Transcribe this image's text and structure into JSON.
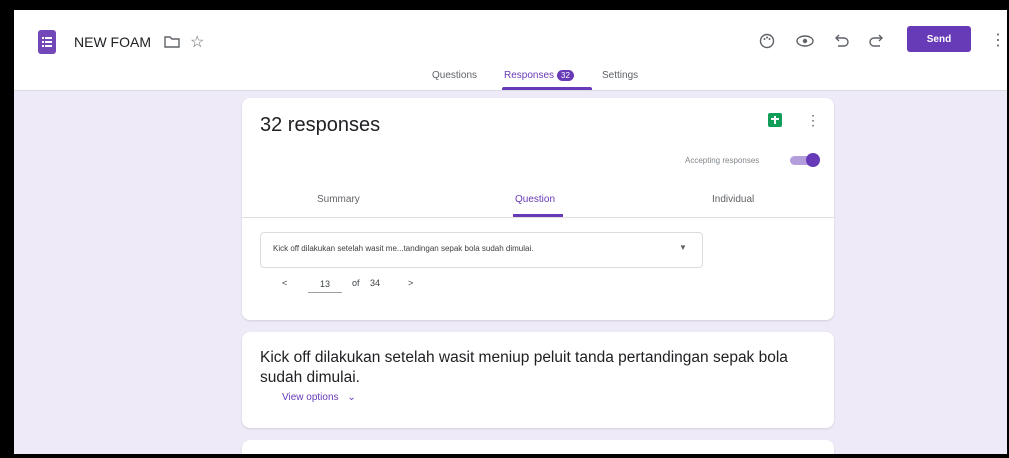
{
  "header": {
    "doc_title": "NEW FOAM",
    "send_label": "Send",
    "icons": [
      "forms-icon",
      "folder-icon",
      "star-icon",
      "palette-icon",
      "preview-icon",
      "undo-icon",
      "redo-icon",
      "more-vert-icon"
    ]
  },
  "main_tabs": {
    "questions": "Questions",
    "responses": "Responses",
    "responses_count": "32",
    "settings": "Settings"
  },
  "responses_card": {
    "title": "32 responses",
    "accepting_label": "Accepting responses",
    "accepting": true,
    "subtabs": {
      "summary": "Summary",
      "question": "Question",
      "individual": "Individual"
    },
    "selected_question": "Kick off dilakukan setelah wasit me...tandingan sepak bola sudah dimulai.",
    "pager": {
      "current": "13",
      "of_label": "of",
      "total": "34",
      "prev": "<",
      "next": ">"
    }
  },
  "question_card": {
    "text": "Kick off dilakukan setelah wasit meniup peluit tanda pertandingan sepak bola sudah dimulai.",
    "view_options": "View options"
  },
  "colors": {
    "accent": "#673ab7",
    "page_bg": "#efeaf7",
    "sheets_green": "#0f9d58"
  }
}
